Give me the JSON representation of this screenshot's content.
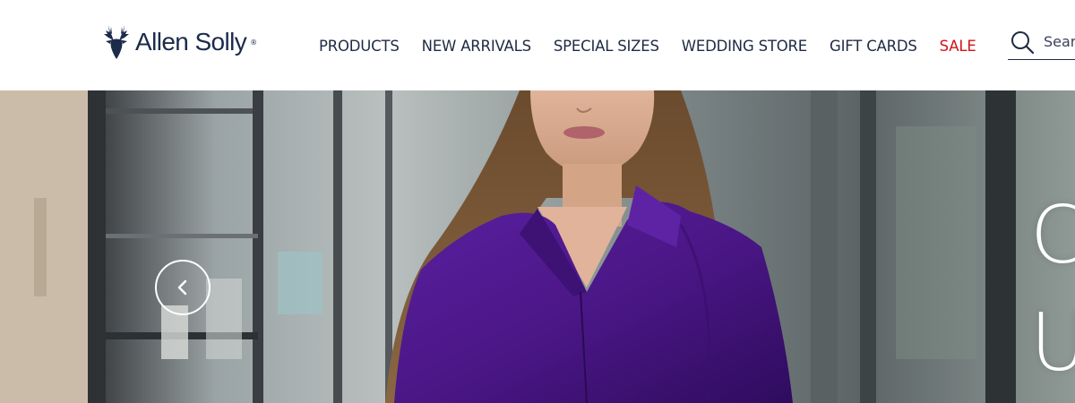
{
  "brand": {
    "name": "Allen Solly",
    "reg_mark": "®",
    "logo_icon": "stag-head-icon",
    "color": "#1c2b4a"
  },
  "nav": {
    "items": [
      {
        "label": "PRODUCTS"
      },
      {
        "label": "NEW ARRIVALS"
      },
      {
        "label": "SPECIAL SIZES"
      },
      {
        "label": "WEDDING STORE"
      },
      {
        "label": "GIFT CARDS"
      },
      {
        "label": "SALE"
      }
    ],
    "text_color": "#1f2a44",
    "sale_color": "#d4141c"
  },
  "search": {
    "placeholder": "Search",
    "icon": "search-icon"
  },
  "hero": {
    "headline_line1": "C",
    "headline_line2": "U",
    "prev_icon": "chevron-left-icon",
    "shirt_color": "#4b1787"
  }
}
